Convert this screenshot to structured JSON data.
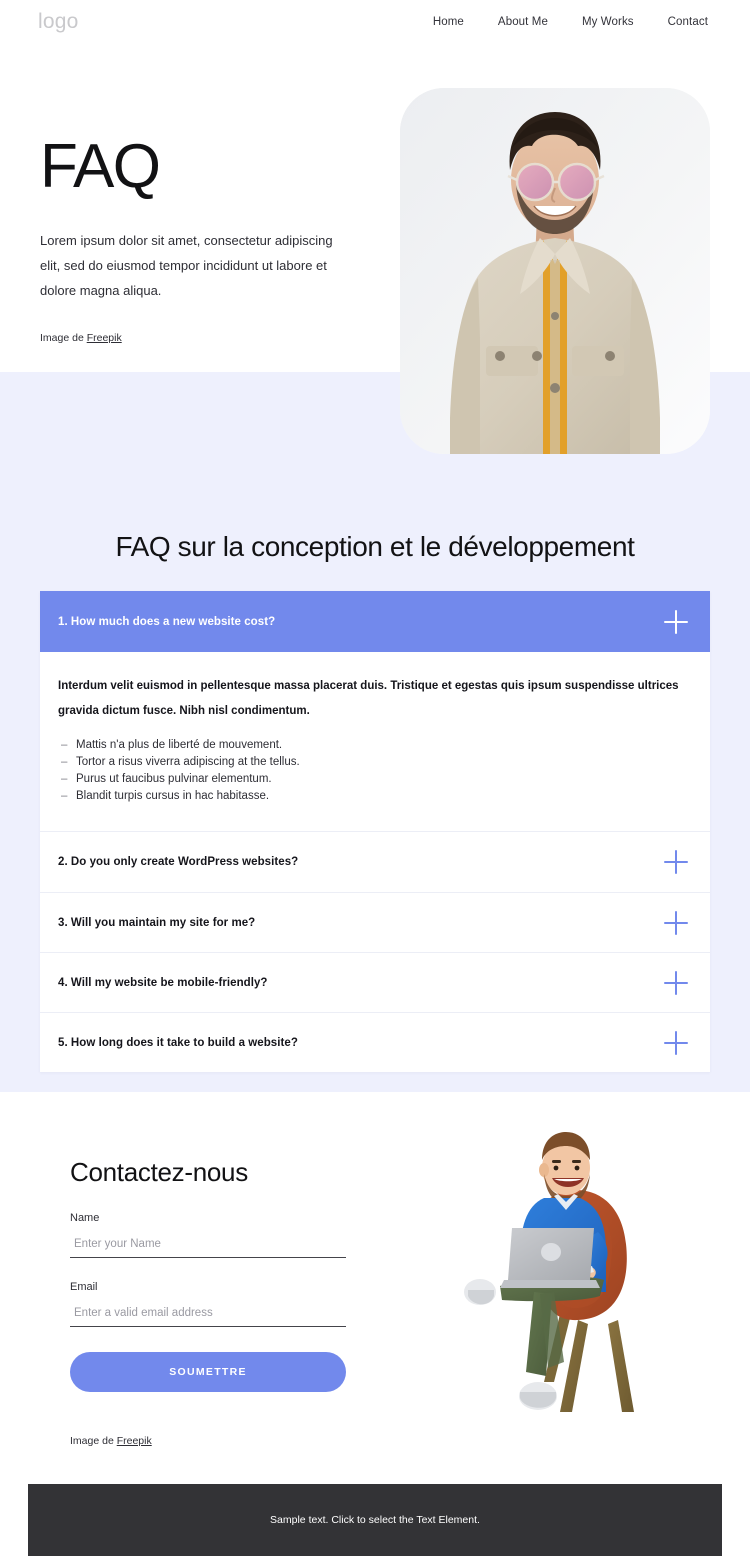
{
  "header": {
    "logo": "logo",
    "nav": [
      {
        "label": "Home"
      },
      {
        "label": "About Me"
      },
      {
        "label": "My Works"
      },
      {
        "label": "Contact"
      }
    ]
  },
  "hero": {
    "title": "FAQ",
    "paragraph": "Lorem ipsum dolor sit amet, consectetur adipiscing elit, sed do eiusmod tempor incididunt ut labore et dolore magna aliqua.",
    "credit_prefix": "Image de ",
    "credit_link": "Freepik",
    "image_alt": "smiling-man-in-beige-denim-jacket-with-pink-sunglasses"
  },
  "faq": {
    "heading": "FAQ sur la conception et le développement",
    "items": [
      {
        "question": "1. How much does a new website cost?",
        "open": true,
        "icon": "plus-icon",
        "lead": "Interdum velit euismod in pellentesque massa placerat duis. Tristique et egestas quis ipsum suspendisse ultrices gravida dictum fusce. Nibh nisl condimentum.",
        "bullets": [
          "Mattis n'a plus de liberté de mouvement.",
          "Tortor a risus viverra adipiscing at the tellus.",
          "Purus ut faucibus pulvinar elementum.",
          "Blandit turpis cursus in hac habitasse."
        ]
      },
      {
        "question": "2. Do you only create WordPress websites?",
        "open": false,
        "icon": "plus-icon"
      },
      {
        "question": "3. Will you maintain my site for me?",
        "open": false,
        "icon": "plus-icon"
      },
      {
        "question": "4. Will my website be mobile-friendly?",
        "open": false,
        "icon": "plus-icon"
      },
      {
        "question": "5. How long does it take to build a website?",
        "open": false,
        "icon": "plus-icon"
      }
    ]
  },
  "contact": {
    "title": "Contactez-nous",
    "name_label": "Name",
    "name_value": "",
    "name_placeholder": "Enter your Name",
    "email_label": "Email",
    "email_value": "",
    "email_placeholder": "Enter a valid email address",
    "submit_label": "SOUMETTRE",
    "credit_prefix": "Image de ",
    "credit_link": "Freepik",
    "illustration_alt": "3d-character-man-sitting-in-armchair-with-laptop"
  },
  "footer": {
    "text": "Sample text. Click to select the Text Element."
  },
  "colors": {
    "accent": "#7289ec",
    "faq_background": "#eef0fd",
    "footer_background": "#333336",
    "text": "#15151b",
    "muted": "#9a9aa2"
  }
}
